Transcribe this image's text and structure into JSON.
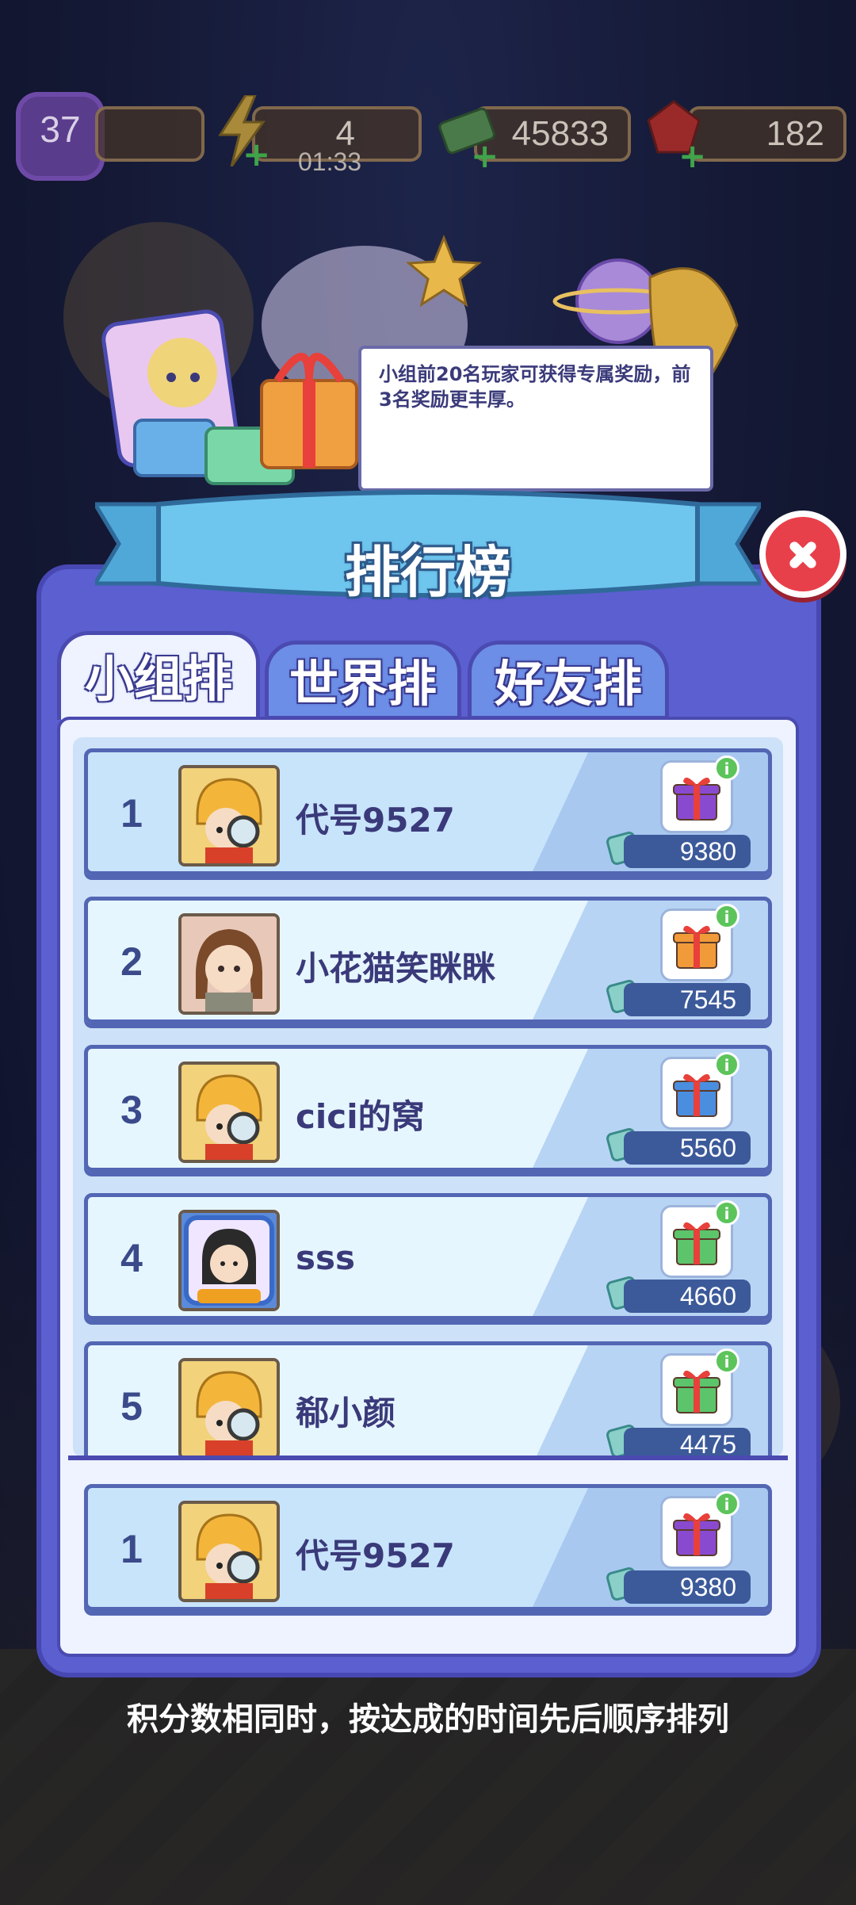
{
  "top_bar": {
    "level": "37",
    "energy": "4",
    "energy_timer": "01:33",
    "cash": "45833",
    "gems": "182"
  },
  "tooltip": "小组前20名玩家可获得专属奖励，前3名奖励更丰厚。",
  "title": "排行榜",
  "tabs": [
    {
      "label": "小组排名",
      "active": true
    },
    {
      "label": "世界排名",
      "active": false
    },
    {
      "label": "好友排名",
      "active": false
    }
  ],
  "rows": [
    {
      "rank": "1",
      "name": "代号9527",
      "score": "9380",
      "avatar": "detective-avatar",
      "gift_color": "#8a4ad0"
    },
    {
      "rank": "2",
      "name": "小花猫笑眯眯",
      "score": "7545",
      "avatar": "brown-hair-girl-avatar",
      "gift_color": "#f09a3a"
    },
    {
      "rank": "3",
      "name": "cici的窝",
      "score": "5560",
      "avatar": "detective-avatar",
      "gift_color": "#4a8ee0"
    },
    {
      "rank": "4",
      "name": "sss",
      "score": "4660",
      "avatar": "game-frame-avatar",
      "gift_color": "#5cc46a"
    },
    {
      "rank": "5",
      "name": "郗小颜",
      "score": "4475",
      "avatar": "detective-avatar",
      "gift_color": "#5cc46a"
    }
  ],
  "my_row": {
    "rank": "1",
    "name": "代号9527",
    "score": "9380",
    "avatar": "detective-avatar",
    "gift_color": "#8a4ad0"
  },
  "footer_note": "积分数相同时，按达成的时间先后顺序排列",
  "colors": {
    "panel": "#5b5fd0",
    "accent": "#e8404a",
    "score_bg": "#3c5a9a"
  }
}
